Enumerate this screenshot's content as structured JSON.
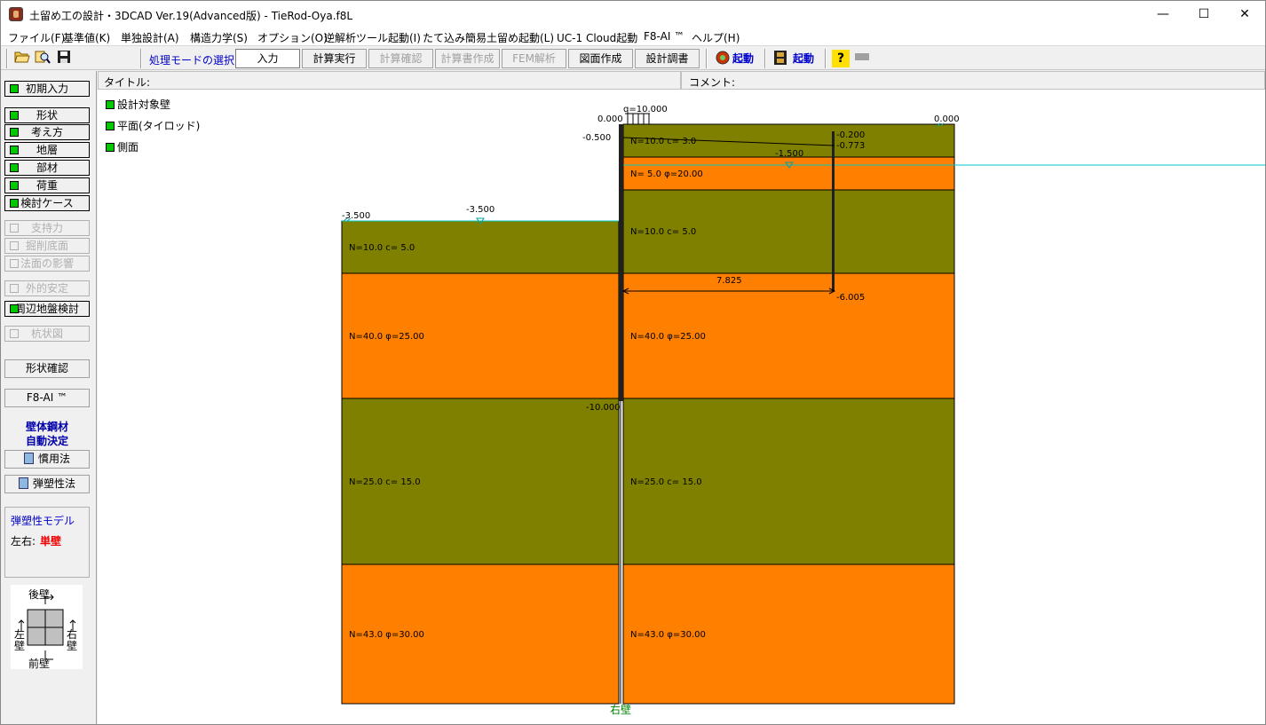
{
  "window": {
    "title": "土留め工の設計・3DCAD Ver.19(Advanced版) - TieRod-Oya.f8L",
    "minimize": "—",
    "maximize": "☐",
    "close": "✕"
  },
  "menu": [
    "ファイル(F)",
    "基準値(K)",
    "単独設計(A)",
    "構造力学(S)",
    "オプション(O)",
    "逆解析ツール起動(I)",
    "たて込み簡易土留め起動(L)",
    "UC-1 Cloud起動",
    "F8-AI ™",
    "ヘルプ(H)"
  ],
  "toolbar": {
    "mode_label": "処理モードの選択",
    "buttons": [
      "入力",
      "計算実行",
      "計算確認",
      "計算書作成",
      "FEM解析",
      "図面作成",
      "設計調書"
    ],
    "launch1": "起動",
    "launch2": "起動",
    "help": "?"
  },
  "left": {
    "group1": [
      "初期入力"
    ],
    "group2": [
      "形状",
      "考え方",
      "地層",
      "部材",
      "荷重",
      "検討ケース"
    ],
    "group3": [
      "支持力",
      "掘削底面",
      "法面の影響"
    ],
    "group4": [
      "外的安定"
    ],
    "group5": [
      "周辺地盤検討"
    ],
    "group6": [
      "杭状図"
    ],
    "shape_confirm": "形状確認",
    "f8ai": "F8-AI ™",
    "note1": "壁体鋼材",
    "note2": "自動決定",
    "btn_kanyo": "慣用法",
    "btn_dansosei": "弾塑性法",
    "model_title": "弾塑性モデル",
    "model_lr_label": "左右:",
    "model_lr_value": "単壁",
    "diagram": {
      "back": "後壁",
      "front": "前壁",
      "left": "左壁",
      "right": "右壁"
    }
  },
  "main": {
    "title_label": "タイトル:",
    "comment_label": "コメント:",
    "tree": [
      "設計対象壁",
      "平面(タイロッド)",
      "側面"
    ]
  },
  "drawing": {
    "surcharge": "q=10.000",
    "left_top_level": "0.000",
    "right_top_level": "0.000",
    "tie_level": "-0.500",
    "anchor_top": "-0.200",
    "anchor_rod": "-0.773",
    "water_right": "-1.500",
    "water_left": "-3.500",
    "left_ground": "-3.500",
    "tie_length": "7.825",
    "anchor_bottom": "-6.005",
    "wall_bottom": "-10.000",
    "bottom_label": "右壁",
    "left_layers": [
      "N=10.0 c=   5.0",
      "N=40.0 φ=25.00",
      "N=25.0 c=  15.0",
      "N=43.0 φ=30.00"
    ],
    "right_layers": [
      "N=10.0 c=   3.0",
      "N= 5.0 φ=20.00",
      "N=10.0 c=   5.0",
      "N=40.0 φ=25.00",
      "N=25.0 c=  15.0",
      "N=43.0 φ=30.00"
    ],
    "colors": {
      "clay": "#808000",
      "sand": "#ff8000",
      "water": "#00c8c8"
    }
  }
}
